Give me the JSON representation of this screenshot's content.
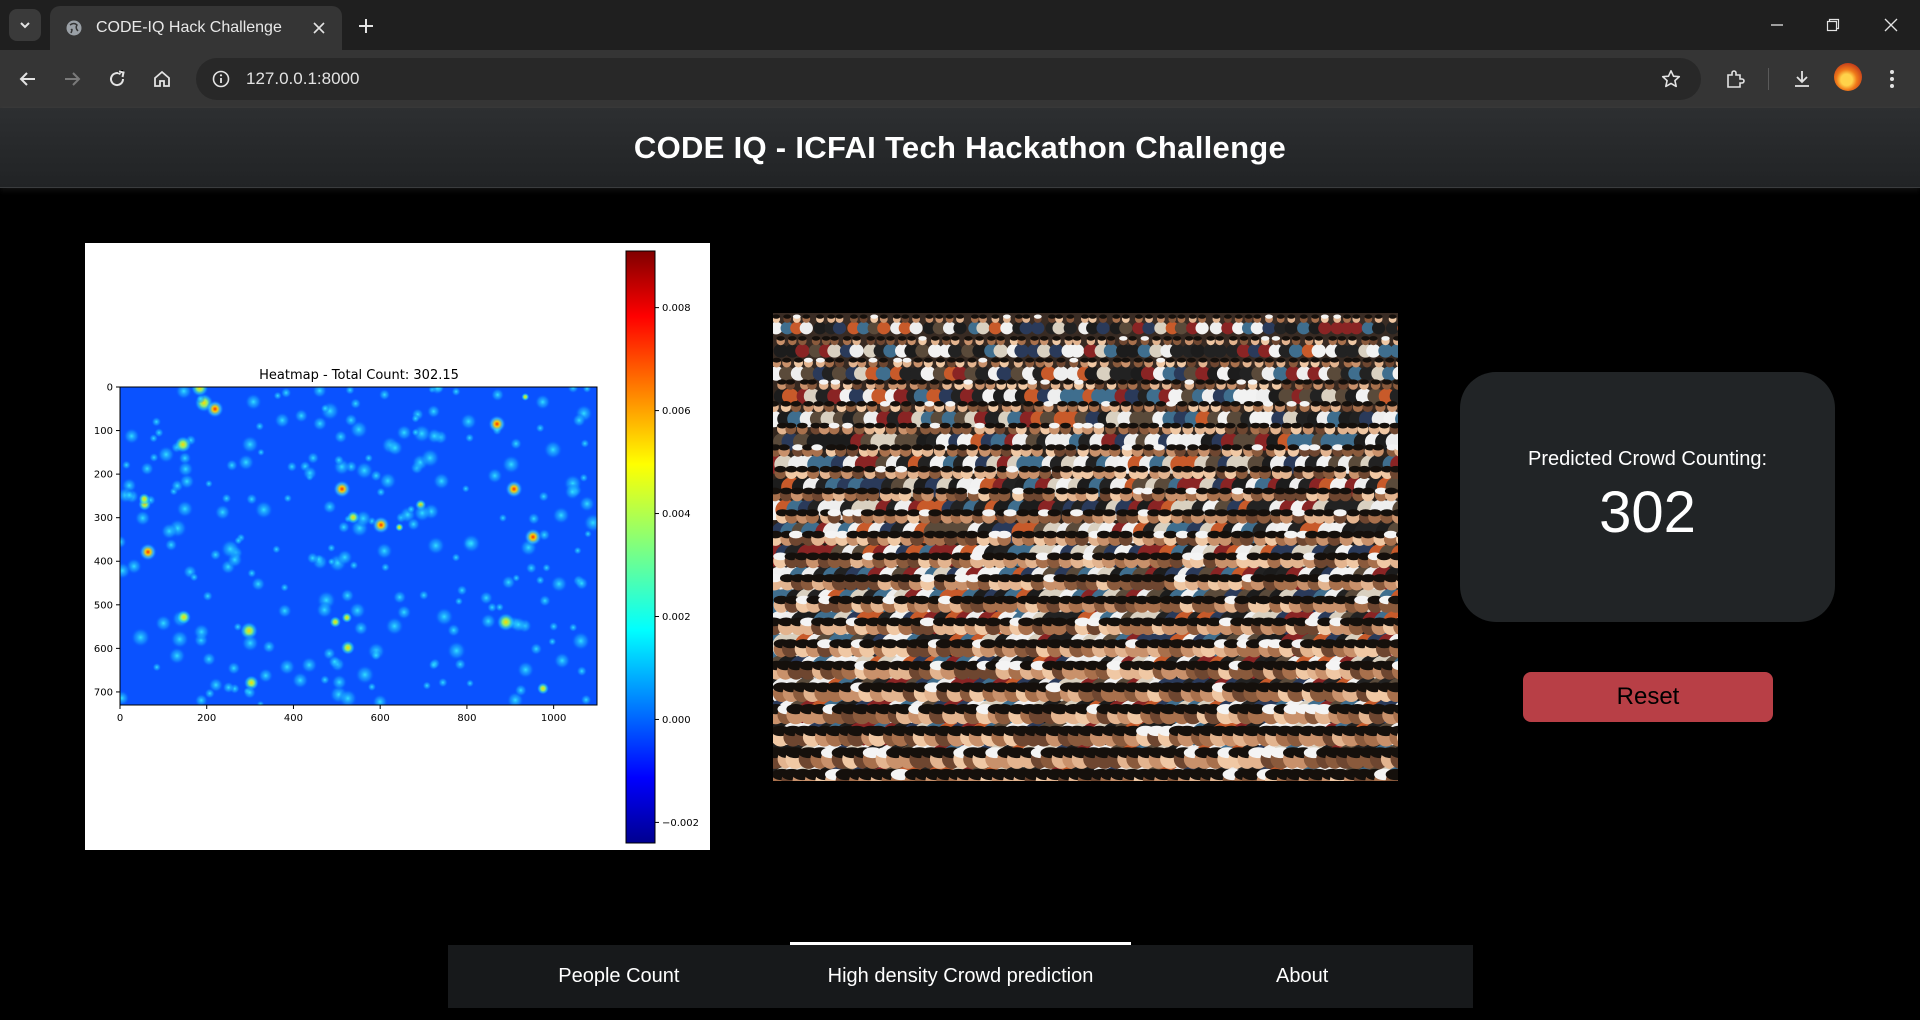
{
  "browser": {
    "tab_title": "CODE-IQ Hack Challenge",
    "url": "127.0.0.1:8000",
    "icons": [
      "tab-search-icon",
      "globe-icon",
      "close-icon",
      "plus-icon",
      "minimize-icon",
      "restore-icon",
      "window-close-icon",
      "back-icon",
      "forward-icon",
      "reload-icon",
      "home-icon",
      "info-icon",
      "star-icon",
      "extensions-icon",
      "download-icon",
      "menu-icon"
    ]
  },
  "header": {
    "title": "CODE IQ - ICFAI Tech Hackathon Challenge"
  },
  "chart_data": {
    "type": "heatmap",
    "title": "Heatmap - Total Count: 302.15",
    "x_ticks": [
      "0",
      "200",
      "400",
      "600",
      "800",
      "1000"
    ],
    "y_ticks": [
      "0",
      "100",
      "200",
      "300",
      "400",
      "500",
      "600",
      "700"
    ],
    "xlim": [
      0,
      1100
    ],
    "ylim": [
      0,
      730
    ],
    "colorbar": {
      "colormap": "jet",
      "ticks": [
        "0.008",
        "0.006",
        "0.004",
        "0.002",
        "0.000",
        "−0.002"
      ],
      "range": [
        -0.0024,
        0.0091
      ]
    },
    "total_count": 302.15
  },
  "prediction": {
    "label": "Predicted Crowd Counting:",
    "value": "302"
  },
  "reset_label": "Reset",
  "nav": {
    "items": [
      {
        "label": "People Count",
        "active": false
      },
      {
        "label": "High density Crowd prediction",
        "active": true
      },
      {
        "label": "About",
        "active": false
      }
    ]
  },
  "colors": {
    "accent_reset": "#b83f46",
    "card_bg": "#212426",
    "header_bg": "#2d2f31"
  }
}
